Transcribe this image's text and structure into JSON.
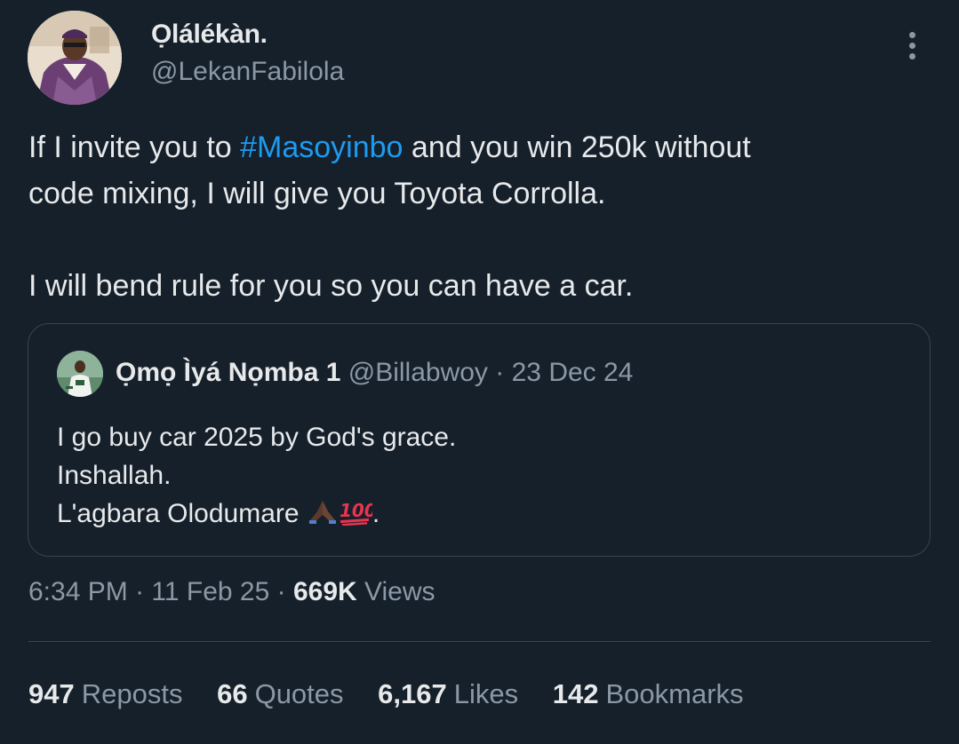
{
  "author": {
    "name": "Ọlálékàn.",
    "handle": "@LekanFabilola"
  },
  "icons": {
    "more": "more-vertical-icon",
    "pray": "folded-hands-emoji",
    "hundred": "hundred-points-emoji"
  },
  "tweet": {
    "line1_before": "If I invite you to ",
    "hashtag": "#Masoyinbo",
    "line1_after": " and you win 250k without",
    "line2": "code mixing, I will give you Toyota Corrolla.",
    "line3": "I will bend rule for you so you can have a car."
  },
  "quote": {
    "name": "Ọmọ Ìyá Nọmba 1",
    "handle": "@Billabwoy",
    "separator": " · ",
    "date": "23 Dec 24",
    "line1": "I go buy car 2025 by God's grace.",
    "line2": "Inshallah.",
    "line3_text": "L'agbara Olodumare ",
    "line3_end": "."
  },
  "meta": {
    "time": "6:34 PM",
    "sep1": " · ",
    "date": "11 Feb 25",
    "sep2": " · ",
    "views_count": "669K",
    "views_label": " Views"
  },
  "stats": [
    {
      "count": "947",
      "label": "Reposts"
    },
    {
      "count": "66",
      "label": "Quotes"
    },
    {
      "count": "6,167",
      "label": "Likes"
    },
    {
      "count": "142",
      "label": "Bookmarks"
    }
  ],
  "colors": {
    "background": "#15202b",
    "text": "#e7e9ea",
    "secondary": "#8b98a5",
    "link": "#1d9bf0",
    "border": "#38444d"
  }
}
